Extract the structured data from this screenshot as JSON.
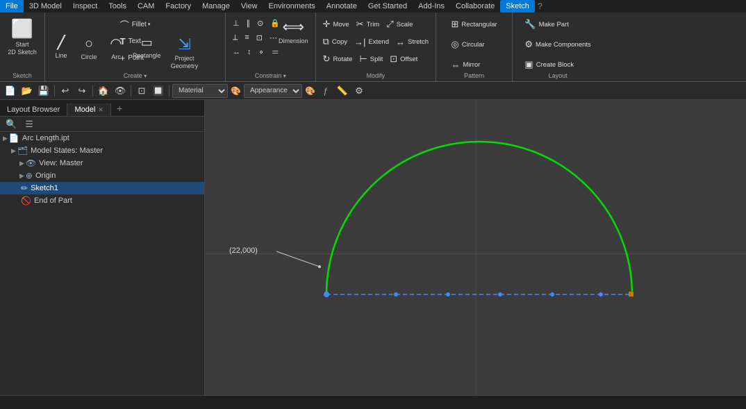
{
  "menubar": {
    "items": [
      {
        "label": "File",
        "active": true
      },
      {
        "label": "3D Model",
        "active": false
      },
      {
        "label": "Inspect",
        "active": false
      },
      {
        "label": "Tools",
        "active": false
      },
      {
        "label": "CAM",
        "active": false
      },
      {
        "label": "Factory",
        "active": false
      },
      {
        "label": "Manage",
        "active": false
      },
      {
        "label": "View",
        "active": false
      },
      {
        "label": "Environments",
        "active": false
      },
      {
        "label": "Annotate",
        "active": false
      },
      {
        "label": "Get Started",
        "active": false
      },
      {
        "label": "Add-Ins",
        "active": false
      },
      {
        "label": "Collaborate",
        "active": false
      },
      {
        "label": "Sketch",
        "active": true,
        "sketch": true
      }
    ]
  },
  "ribbon": {
    "sections": [
      {
        "name": "sketch-section",
        "label": "Sketch",
        "tools": [
          {
            "id": "start-2d-sketch",
            "icon": "⬜",
            "label": "Start\n2D Sketch",
            "large": true
          }
        ]
      },
      {
        "name": "create-section",
        "label": "Create",
        "tools": [
          {
            "id": "line",
            "icon": "╱",
            "label": "Line"
          },
          {
            "id": "circle",
            "icon": "○",
            "label": "Circle"
          },
          {
            "id": "arc",
            "icon": "◠",
            "label": "Arc"
          },
          {
            "id": "rectangle",
            "icon": "▭",
            "label": "Rectangle"
          },
          {
            "id": "fillet",
            "icon": "⌒",
            "label": "Fillet ▾"
          },
          {
            "id": "text",
            "icon": "𝐓",
            "label": "Text"
          },
          {
            "id": "point",
            "icon": "·",
            "label": "Point"
          },
          {
            "id": "project-geometry",
            "icon": "⇲",
            "label": "Project\nGeometry",
            "large": true
          }
        ]
      },
      {
        "name": "constrain-section",
        "label": "Constrain",
        "tools": [
          {
            "id": "dimension",
            "icon": "⟺",
            "label": "Dimension",
            "large": true
          }
        ]
      },
      {
        "name": "modify-section",
        "label": "Modify",
        "tools": [
          {
            "id": "move",
            "icon": "✛",
            "label": "Move"
          },
          {
            "id": "copy",
            "icon": "⧉",
            "label": "Copy"
          },
          {
            "id": "rotate",
            "icon": "↻",
            "label": "Rotate"
          },
          {
            "id": "trim",
            "icon": "✂",
            "label": "Trim"
          },
          {
            "id": "extend",
            "icon": "→|",
            "label": "Extend"
          },
          {
            "id": "split",
            "icon": "⊢",
            "label": "Split"
          },
          {
            "id": "scale",
            "icon": "⤢",
            "label": "Scale"
          },
          {
            "id": "stretch",
            "icon": "↔",
            "label": "Stretch"
          },
          {
            "id": "offset",
            "icon": "⊡",
            "label": "Offset"
          }
        ]
      },
      {
        "name": "pattern-section",
        "label": "Pattern",
        "tools": [
          {
            "id": "rectangular",
            "icon": "⊞",
            "label": "Rectangular"
          },
          {
            "id": "circular-pattern",
            "icon": "◎",
            "label": "Circular"
          },
          {
            "id": "mirror",
            "icon": "⇔",
            "label": "Mirror"
          }
        ]
      },
      {
        "name": "layout-section",
        "label": "Layout",
        "tools": [
          {
            "id": "make-part",
            "icon": "🔧",
            "label": "Make Part"
          },
          {
            "id": "make-components",
            "icon": "⚙",
            "label": "Make Components"
          },
          {
            "id": "create-block",
            "icon": "▣",
            "label": "Create Block"
          }
        ]
      }
    ]
  },
  "toolbar2": {
    "material_placeholder": "Material",
    "appearance_placeholder": "Appearance"
  },
  "sidebar": {
    "tabs": [
      {
        "label": "Layout Browser",
        "active": false
      },
      {
        "label": "Model",
        "active": true
      }
    ],
    "tree": [
      {
        "id": "arc-length",
        "label": "Arc Length.ipt",
        "indent": 0,
        "icon": "📄",
        "arrow": ""
      },
      {
        "id": "model-states",
        "label": "Model States: Master",
        "indent": 1,
        "icon": "🗂",
        "arrow": "▶"
      },
      {
        "id": "view-master",
        "label": "View: Master",
        "indent": 2,
        "icon": "👁",
        "arrow": "▶"
      },
      {
        "id": "origin",
        "label": "Origin",
        "indent": 2,
        "icon": "⊕",
        "arrow": "▶"
      },
      {
        "id": "sketch1",
        "label": "Sketch1",
        "indent": 2,
        "icon": "✏",
        "arrow": "",
        "selected": true
      },
      {
        "id": "end-of-part",
        "label": "End of Part",
        "indent": 2,
        "icon": "🚫",
        "arrow": ""
      }
    ]
  },
  "viewport": {
    "annotation_label": "(22,000)",
    "arc_color": "#00e000",
    "line_color": "#4488ff"
  },
  "status_bar": {
    "text": ""
  }
}
